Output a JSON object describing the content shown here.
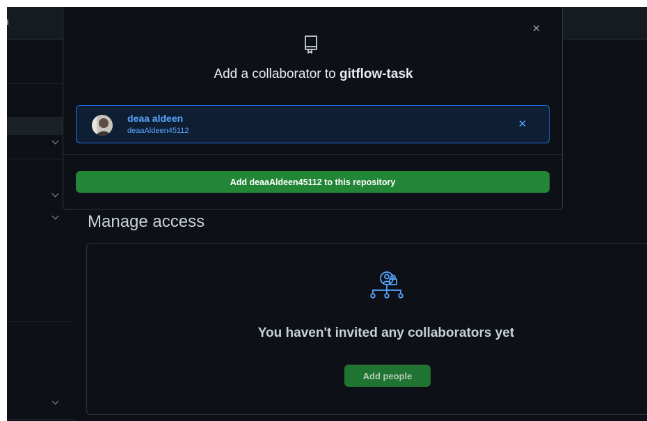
{
  "dialog": {
    "close_icon": "x-icon",
    "repo_icon": "repo-icon",
    "title_prefix": "Add a collaborator to ",
    "repo_name": "gitflow-task",
    "selected_user": {
      "name": "deaa aldeen",
      "login": "deaaAldeen45112",
      "remove_icon": "x-icon"
    },
    "add_button_label": "Add deaaAldeen45112 to this repository"
  },
  "main": {
    "section_title": "Manage access",
    "empty_state": {
      "icon": "people-lock-icon",
      "message": "You haven't invited any collaborators yet",
      "add_people_label": "Add people"
    }
  },
  "colors": {
    "background": "#0d1117",
    "accent_blue": "#58a6ff",
    "primary_green": "#238636"
  }
}
